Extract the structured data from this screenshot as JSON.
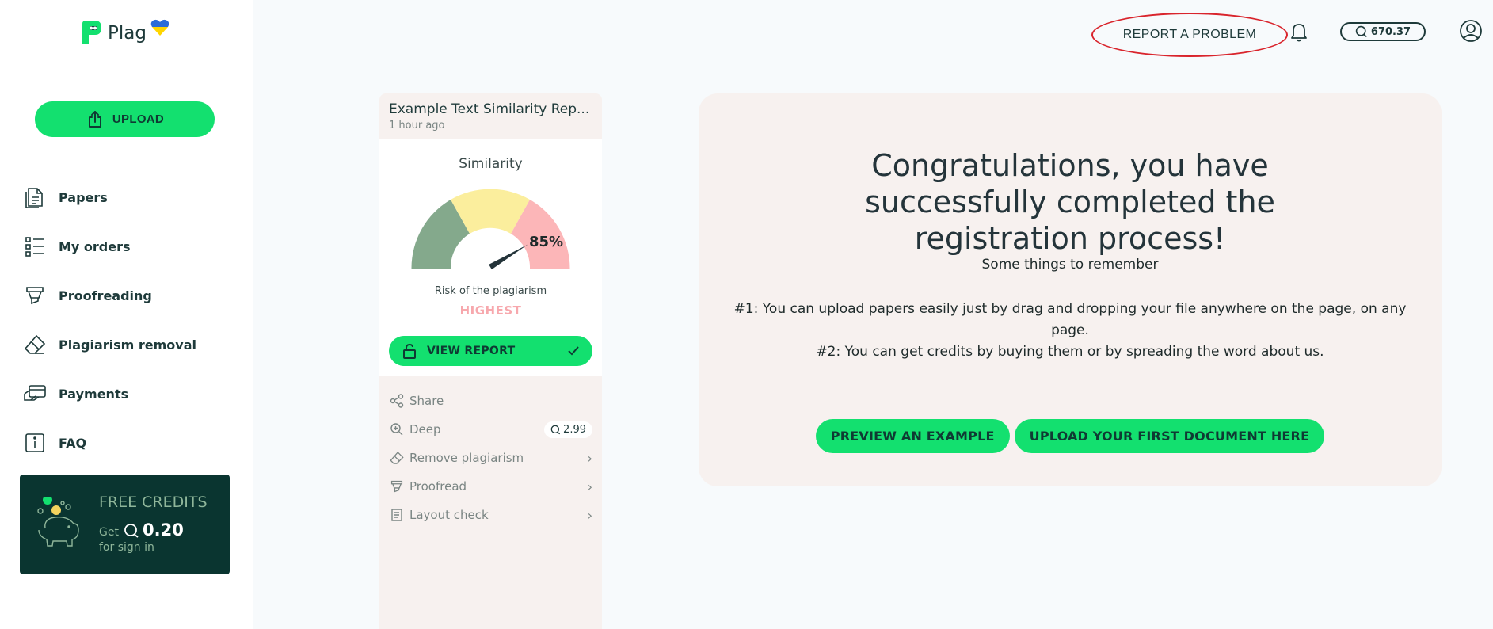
{
  "brand": {
    "name": "Plag"
  },
  "sidebar": {
    "upload_label": "UPLOAD",
    "items": [
      {
        "label": "Papers",
        "icon": "document-icon"
      },
      {
        "label": "My orders",
        "icon": "list-icon"
      },
      {
        "label": "Proofreading",
        "icon": "marker-icon"
      },
      {
        "label": "Plagiarism removal",
        "icon": "eraser-icon"
      },
      {
        "label": "Payments",
        "icon": "card-payment-icon"
      },
      {
        "label": "FAQ",
        "icon": "info-icon"
      }
    ],
    "promo": {
      "title": "FREE CREDITS",
      "get": "Get",
      "amount": "0.20",
      "sub": "for sign in"
    }
  },
  "topbar": {
    "report_problem": "REPORT A PROBLEM",
    "credits": "670.37",
    "highlight_color": "#d9242c"
  },
  "report_card": {
    "title": "Example Text Similarity Rep...",
    "time": "1 hour ago",
    "similarity_label": "Similarity",
    "similarity_value": 85,
    "similarity_text": "85%",
    "risk_label": "Risk of the plagiarism",
    "risk_level": "HIGHEST",
    "view_report": "VIEW REPORT",
    "actions": [
      {
        "label": "Share",
        "icon": "share-icon"
      },
      {
        "label": "Deep",
        "icon": "zoom-plus-icon",
        "badge": "2.99"
      },
      {
        "label": "Remove plagiarism",
        "icon": "eraser-icon",
        "chevron": "›"
      },
      {
        "label": "Proofread",
        "icon": "marker-icon",
        "chevron": "›"
      },
      {
        "label": "Layout check",
        "icon": "layout-icon",
        "chevron": "›"
      }
    ]
  },
  "main": {
    "congrats": "Congratulations, you have successfully completed the registration process!",
    "remember": "Some things to remember",
    "tip1": "#1: You can upload papers easily just by drag and dropping your file anywhere on the page, on any page.",
    "tip2": "#2: You can get credits by buying them or by spreading the word about us.",
    "cta_preview": "PREVIEW AN EXAMPLE",
    "cta_upload": "UPLOAD YOUR FIRST DOCUMENT HERE"
  },
  "colors": {
    "accent": "#13e06f",
    "dark": "#0a3530",
    "panel": "#f7f1ef",
    "gauge_green": "#84a98c",
    "gauge_yellow": "#fbee9d",
    "gauge_red": "#fcb6b8"
  }
}
